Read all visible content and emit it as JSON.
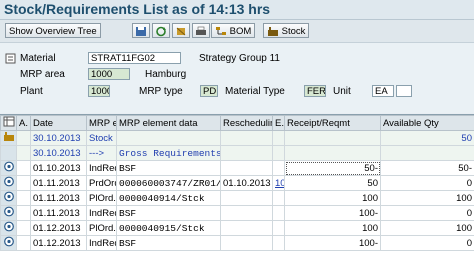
{
  "title": "Stock/Requirements List as of 14:13 hrs",
  "toolbar": {
    "overview_tree": "Show Overview Tree",
    "bom": "BOM",
    "stock": "Stock"
  },
  "header": {
    "material_label": "Material",
    "material_value": "STRAT11FG02",
    "strategy_group": "Strategy Group 11",
    "mrp_area_label": "MRP area",
    "mrp_area_value": "1000",
    "mrp_area_name": "Hamburg",
    "plant_label": "Plant",
    "plant_value": "1000",
    "mrp_type_label": "MRP type",
    "mrp_type_value": "PD",
    "material_type_label": "Material Type",
    "material_type_value": "FERT",
    "unit_label": "Unit",
    "unit_value": "EA"
  },
  "table": {
    "columns": [
      "A.",
      "Date",
      "MRP el.",
      "MRP element data",
      "Reschedulin",
      "E.",
      "Receipt/Reqmt",
      "Available Qty"
    ],
    "rows": [
      {
        "icon": "factory-icon",
        "a": "",
        "date": "30.10.2013",
        "elem": "Stock",
        "data": "",
        "resch": "",
        "e": "",
        "qty": "",
        "avail": "50"
      },
      {
        "icon": "",
        "a": "",
        "date": "30.10.2013",
        "elem": "--->",
        "data": "Gross Requirements",
        "resch": "",
        "e": "",
        "qty": "",
        "avail": ""
      },
      {
        "icon": "document-icon",
        "a": "",
        "date": "01.10.2013",
        "elem": "IndReq",
        "data": "BSF",
        "resch": "",
        "e": "",
        "qty": "50-",
        "avail": "50-"
      },
      {
        "icon": "document-icon",
        "a": "",
        "date": "01.11.2013",
        "elem": "PrdOrd.",
        "data": "000060003747/ZR01/PD",
        "resch": "01.10.2013",
        "e": "10",
        "qty": "50",
        "avail": "0"
      },
      {
        "icon": "document-icon",
        "a": "",
        "date": "01.11.2013",
        "elem": "PlOrd.",
        "data": "0000040914/Stck",
        "resch": "",
        "e": "",
        "qty": "100",
        "avail": "100"
      },
      {
        "icon": "document-icon",
        "a": "",
        "date": "01.11.2013",
        "elem": "IndReq",
        "data": "BSF",
        "resch": "",
        "e": "",
        "qty": "100-",
        "avail": "0"
      },
      {
        "icon": "document-icon",
        "a": "",
        "date": "01.12.2013",
        "elem": "PlOrd.",
        "data": "0000040915/Stck",
        "resch": "",
        "e": "",
        "qty": "100",
        "avail": "100"
      },
      {
        "icon": "document-icon",
        "a": "",
        "date": "01.12.2013",
        "elem": "IndReq",
        "data": "BSF",
        "resch": "",
        "e": "",
        "qty": "100-",
        "avail": "0"
      }
    ]
  }
}
